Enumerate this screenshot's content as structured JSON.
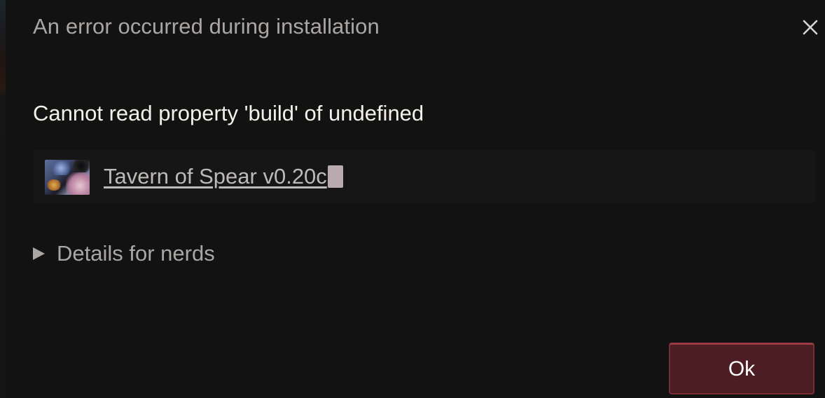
{
  "dialog": {
    "title": "An error occurred during installation",
    "close_icon": "close-icon",
    "error_message": "Cannot read property 'build' of undefined",
    "game": {
      "title": "Tavern of Spear v0.20c",
      "thumbnail_icon": "game-thumbnail"
    },
    "details": {
      "label": "Details for nerds",
      "icon": "disclosure-triangle-icon",
      "expanded": false
    },
    "ok_button": {
      "label": "Ok"
    }
  },
  "colors": {
    "background": "#131212",
    "accent_button": "#4c1d22",
    "accent_border": "#9c3a45",
    "title_text": "#a9a6a4",
    "message_text": "#f3f1ea"
  }
}
